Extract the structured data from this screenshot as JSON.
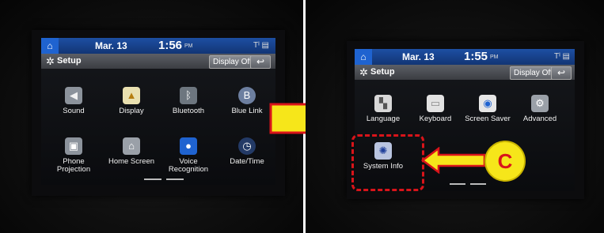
{
  "colors": {
    "accent": "#1d4fa3",
    "highlight": "#d9141a",
    "callout": "#f6e61a"
  },
  "left": {
    "status": {
      "date": "Mar. 13",
      "time": "1:56",
      "time_suffix": "PM",
      "indicator": "Tᴵ ▤"
    },
    "title": "Setup",
    "display_off": "Display Off",
    "back": "↩",
    "items": [
      {
        "label": "Sound",
        "icon": "speaker-icon"
      },
      {
        "label": "Display",
        "icon": "display-icon"
      },
      {
        "label": "Bluetooth",
        "icon": "bluetooth-icon"
      },
      {
        "label": "Blue Link",
        "icon": "bluelink-icon"
      },
      {
        "label": "Phone Projection",
        "icon": "phone-projection-icon"
      },
      {
        "label": "Home Screen",
        "icon": "home-screen-icon"
      },
      {
        "label": "Voice Recognition",
        "icon": "microphone-icon"
      },
      {
        "label": "Date/Time",
        "icon": "clock-icon"
      }
    ]
  },
  "right": {
    "status": {
      "date": "Mar. 13",
      "time": "1:55",
      "time_suffix": "PM",
      "indicator": "Tᴵ ▤"
    },
    "title": "Setup",
    "display_off": "Display Off",
    "back": "↩",
    "items": [
      {
        "label": "Language",
        "icon": "language-icon"
      },
      {
        "label": "Keyboard",
        "icon": "keyboard-icon"
      },
      {
        "label": "Screen Saver",
        "icon": "screen-saver-icon"
      },
      {
        "label": "Advanced",
        "icon": "advanced-icon"
      },
      {
        "label": "System Info",
        "icon": "system-info-icon"
      }
    ]
  },
  "callout_letter": "C"
}
